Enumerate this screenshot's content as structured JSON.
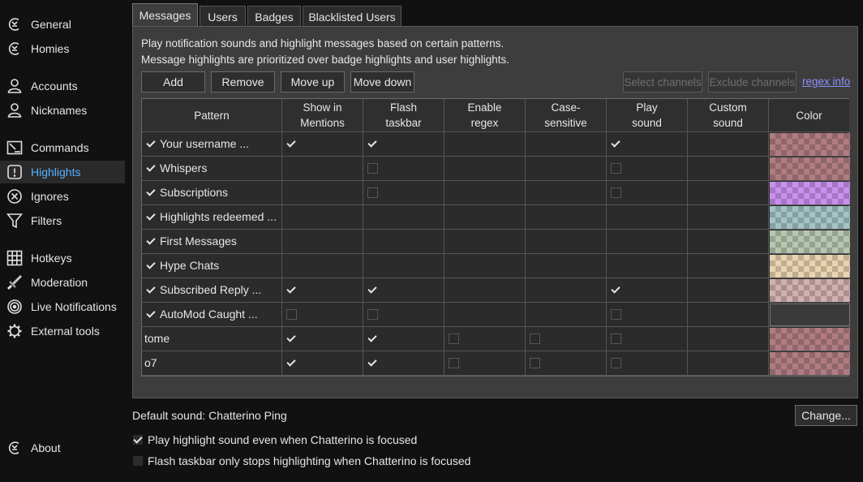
{
  "sidebar": {
    "items": [
      {
        "label": "General",
        "icon": "chatterino-logo-icon"
      },
      {
        "label": "Homies",
        "icon": "chatterino-logo-icon"
      },
      {
        "label": "Accounts",
        "icon": "user-icon"
      },
      {
        "label": "Nicknames",
        "icon": "user-icon"
      },
      {
        "label": "Commands",
        "icon": "terminal-icon"
      },
      {
        "label": "Highlights",
        "icon": "exclamation-box-icon"
      },
      {
        "label": "Ignores",
        "icon": "circle-x-icon"
      },
      {
        "label": "Filters",
        "icon": "funnel-icon"
      },
      {
        "label": "Hotkeys",
        "icon": "keyboard-grid-icon"
      },
      {
        "label": "Moderation",
        "icon": "sword-icon"
      },
      {
        "label": "Live Notifications",
        "icon": "broadcast-icon"
      },
      {
        "label": "External tools",
        "icon": "gear-icon"
      },
      {
        "label": "About",
        "icon": "chatterino-logo-icon"
      }
    ],
    "active": "Highlights",
    "active_color": "#55b3ff"
  },
  "tabs": [
    "Messages",
    "Users",
    "Badges",
    "Blacklisted Users"
  ],
  "active_tab": "Messages",
  "description": {
    "line1": "Play notification sounds and highlight messages based on certain patterns.",
    "line2": "Message highlights are prioritized over badge highlights and user highlights."
  },
  "toolbar": {
    "add": "Add",
    "remove": "Remove",
    "move_up": "Move up",
    "move_down": "Move down",
    "select_channels": "Select channels",
    "exclude_channels": "Exclude channels",
    "regex_info": "regex info"
  },
  "table": {
    "headers": [
      "Pattern",
      "Show in\nMentions",
      "Flash\ntaskbar",
      "Enable\nregex",
      "Case-\nsensitive",
      "Play\nsound",
      "Custom\nsound",
      "Color"
    ],
    "rows": [
      {
        "enabled": true,
        "pattern": "Your username ...",
        "mentions": true,
        "flash": true,
        "regex": null,
        "case": null,
        "play": true,
        "color": "#b07c82"
      },
      {
        "enabled": true,
        "pattern": "Whispers",
        "mentions": null,
        "flash": false,
        "regex": null,
        "case": null,
        "play": false,
        "color": "#b07c82"
      },
      {
        "enabled": true,
        "pattern": "Subscriptions",
        "mentions": null,
        "flash": false,
        "regex": null,
        "case": null,
        "play": false,
        "color": "#c990ee"
      },
      {
        "enabled": true,
        "pattern": "Highlights redeemed ...",
        "mentions": null,
        "flash": null,
        "regex": null,
        "case": null,
        "play": null,
        "color": "#a3c3c6"
      },
      {
        "enabled": true,
        "pattern": "First Messages",
        "mentions": null,
        "flash": null,
        "regex": null,
        "case": null,
        "play": null,
        "color": "#b7c6b0"
      },
      {
        "enabled": true,
        "pattern": "Hype Chats",
        "mentions": null,
        "flash": null,
        "regex": null,
        "case": null,
        "play": null,
        "color": "#e9d3b0"
      },
      {
        "enabled": true,
        "pattern": "Subscribed Reply ...",
        "mentions": true,
        "flash": true,
        "regex": null,
        "case": null,
        "play": true,
        "color": "#d2b0b0"
      },
      {
        "enabled": true,
        "pattern": "AutoMod Caught ...",
        "mentions": false,
        "flash": false,
        "regex": null,
        "case": null,
        "play": false,
        "color": "none"
      },
      {
        "enabled": null,
        "pattern": "tome",
        "mentions": true,
        "flash": true,
        "regex": false,
        "case": false,
        "play": false,
        "color": "#b07c82"
      },
      {
        "enabled": null,
        "pattern": "o7",
        "mentions": true,
        "flash": true,
        "regex": false,
        "case": false,
        "play": false,
        "color": "#b07c82"
      }
    ]
  },
  "default_sound": {
    "label": "Default sound: Chatterino Ping",
    "change_button": "Change..."
  },
  "options": [
    {
      "label": "Play highlight sound even when Chatterino is focused",
      "checked": true
    },
    {
      "label": "Flash taskbar only stops highlighting when Chatterino is focused",
      "checked": false
    }
  ]
}
